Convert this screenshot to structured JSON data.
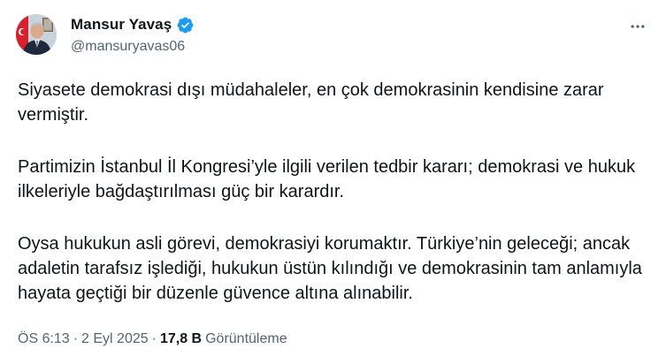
{
  "author": {
    "display_name": "Mansur Yavaş",
    "handle": "@mansuryavas06",
    "verified": true,
    "avatar_icon": "profile-photo"
  },
  "actions": {
    "more_icon": "more-horizontal-icon"
  },
  "tweet": {
    "paragraphs": [
      "Siyasete demokrasi dışı müdahaleler, en çok demokrasinin kendisine zarar vermiştir.",
      "Partimizin İstanbul İl Kongresi’yle ilgili verilen tedbir kararı; demokrasi ve hukuk ilkeleriyle bağdaştırılması güç bir karardır.",
      "Oysa hukukun asli görevi, demokrasiyi korumaktır. Türkiye’nin geleceği; ancak adaletin tarafsız işlediği, hukukun üstün kılındığı ve demokrasinin tam anlamıyla hayata geçtiği bir düzenle güvence altına alınabilir."
    ]
  },
  "meta": {
    "time": "ÖS 6:13",
    "separator": "·",
    "date": "2 Eyl 2025",
    "views_count": "17,8 B",
    "views_label": "Görüntüleme"
  },
  "colors": {
    "text_primary": "#0f1419",
    "text_secondary": "#536471",
    "verified_blue": "#1d9bf0"
  }
}
